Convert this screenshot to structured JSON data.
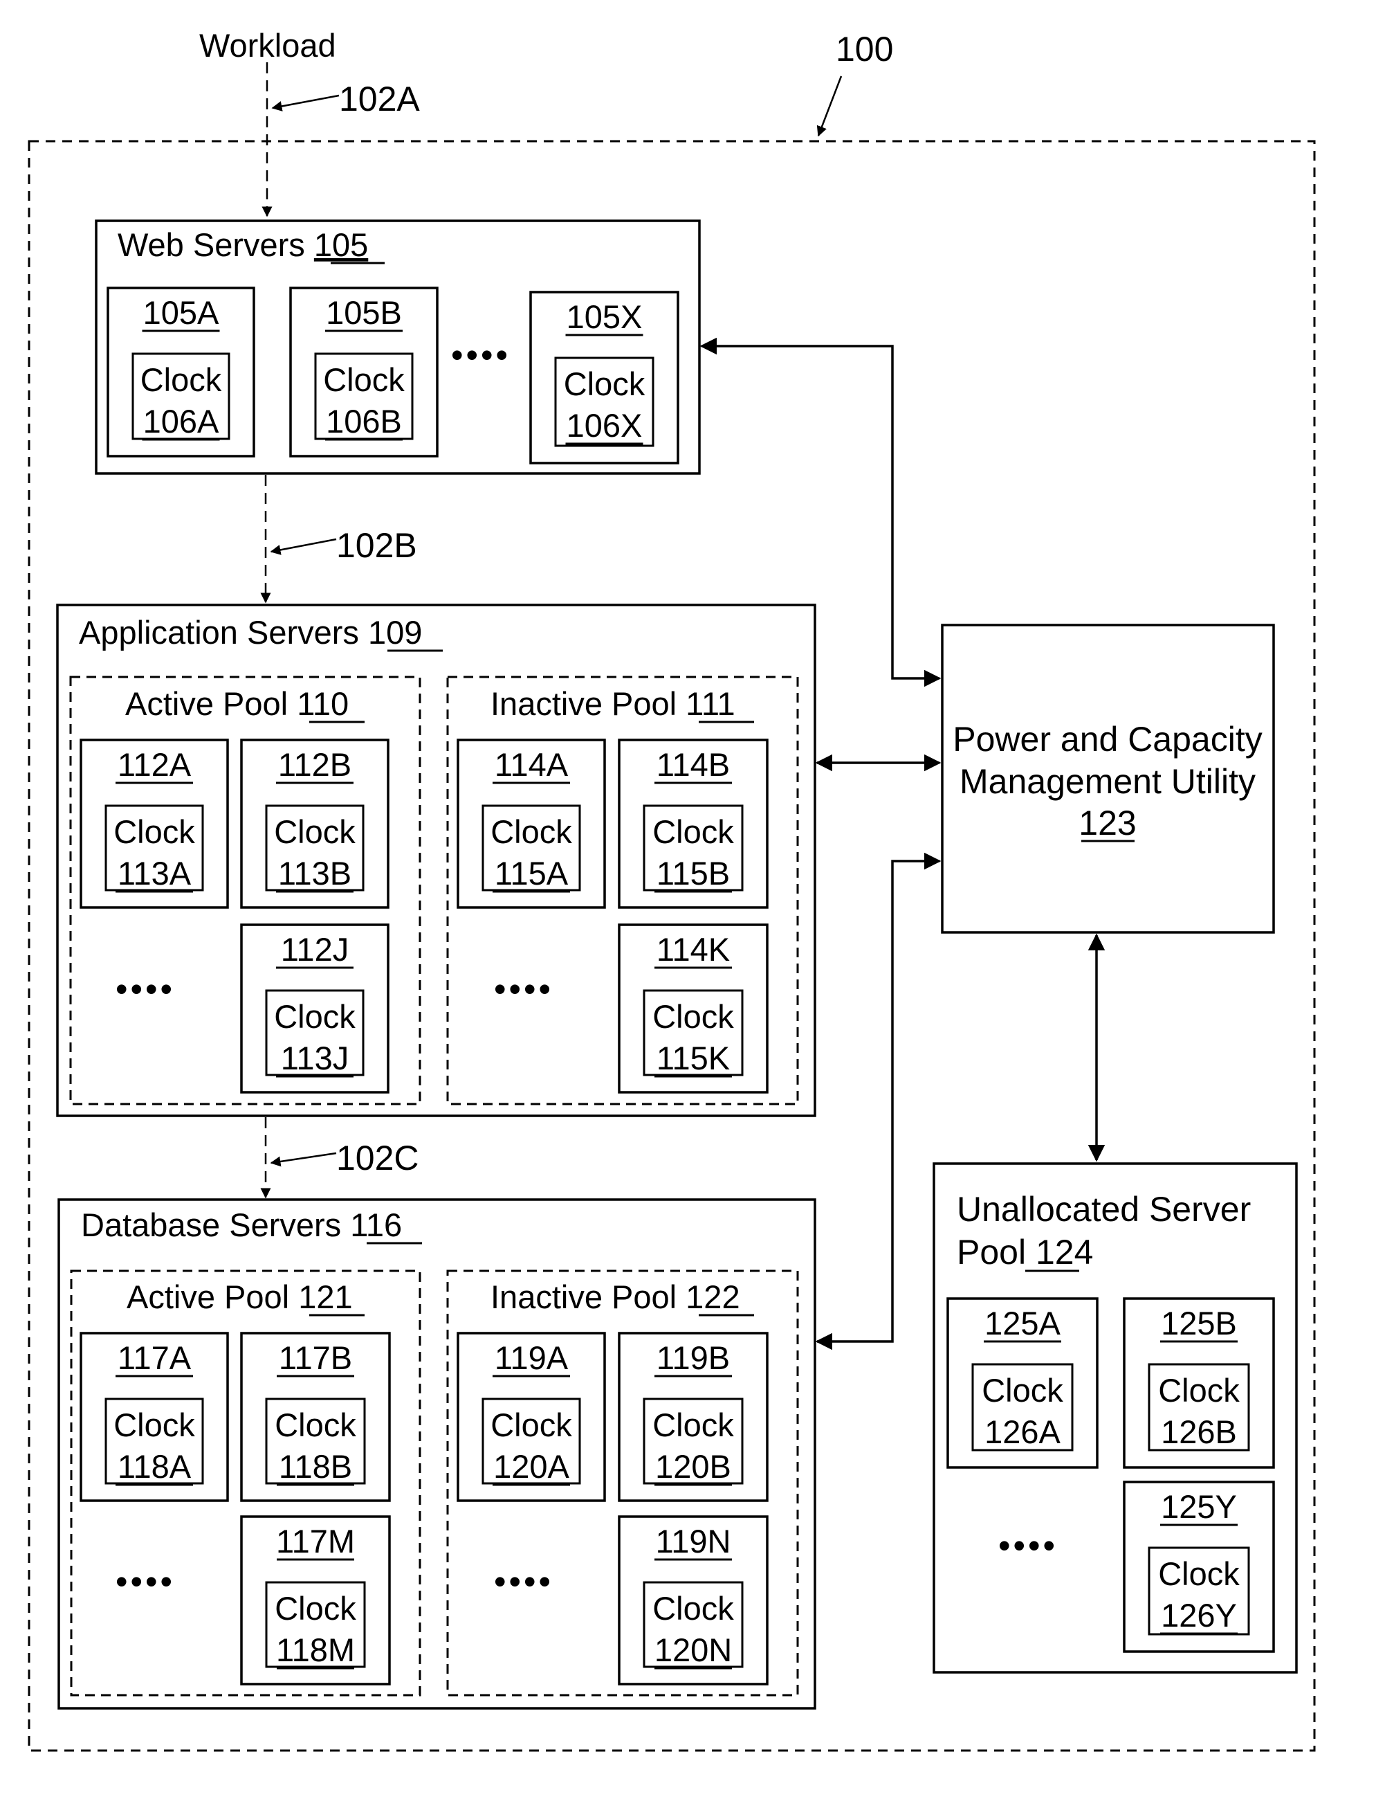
{
  "figure": {
    "reference": "100",
    "workload_label": "Workload",
    "flows": [
      "102A",
      "102B",
      "102C"
    ]
  },
  "web_servers": {
    "title": "Web Servers",
    "ref": "105",
    "servers": [
      {
        "id": "105A",
        "clock_label": "Clock",
        "clock_ref": "106A"
      },
      {
        "id": "105B",
        "clock_label": "Clock",
        "clock_ref": "106B"
      },
      {
        "id": "105X",
        "clock_label": "Clock",
        "clock_ref": "106X"
      }
    ],
    "ellipsis": "••••"
  },
  "application_servers": {
    "title": "Application Servers",
    "ref": "109",
    "active_pool": {
      "title": "Active Pool",
      "ref": "110",
      "servers": [
        {
          "id": "112A",
          "clock_label": "Clock",
          "clock_ref": "113A"
        },
        {
          "id": "112B",
          "clock_label": "Clock",
          "clock_ref": "113B"
        },
        {
          "id": "112J",
          "clock_label": "Clock",
          "clock_ref": "113J"
        }
      ],
      "ellipsis": "••••"
    },
    "inactive_pool": {
      "title": "Inactive Pool",
      "ref": "111",
      "servers": [
        {
          "id": "114A",
          "clock_label": "Clock",
          "clock_ref": "115A"
        },
        {
          "id": "114B",
          "clock_label": "Clock",
          "clock_ref": "115B"
        },
        {
          "id": "114K",
          "clock_label": "Clock",
          "clock_ref": "115K"
        }
      ],
      "ellipsis": "••••"
    }
  },
  "database_servers": {
    "title": "Database Servers",
    "ref": "116",
    "active_pool": {
      "title": "Active Pool",
      "ref": "121",
      "servers": [
        {
          "id": "117A",
          "clock_label": "Clock",
          "clock_ref": "118A"
        },
        {
          "id": "117B",
          "clock_label": "Clock",
          "clock_ref": "118B"
        },
        {
          "id": "117M",
          "clock_label": "Clock",
          "clock_ref": "118M"
        }
      ],
      "ellipsis": "••••"
    },
    "inactive_pool": {
      "title": "Inactive Pool",
      "ref": "122",
      "servers": [
        {
          "id": "119A",
          "clock_label": "Clock",
          "clock_ref": "120A"
        },
        {
          "id": "119B",
          "clock_label": "Clock",
          "clock_ref": "120B"
        },
        {
          "id": "119N",
          "clock_label": "Clock",
          "clock_ref": "120N"
        }
      ],
      "ellipsis": "••••"
    }
  },
  "power_utility": {
    "line1": "Power and Capacity",
    "line2": "Management Utility",
    "ref": "123"
  },
  "unallocated_pool": {
    "line1": "Unallocated Server",
    "line2": "Pool",
    "ref": "124",
    "servers": [
      {
        "id": "125A",
        "clock_label": "Clock",
        "clock_ref": "126A"
      },
      {
        "id": "125B",
        "clock_label": "Clock",
        "clock_ref": "126B"
      },
      {
        "id": "125Y",
        "clock_label": "Clock",
        "clock_ref": "126Y"
      }
    ],
    "ellipsis": "••••"
  }
}
